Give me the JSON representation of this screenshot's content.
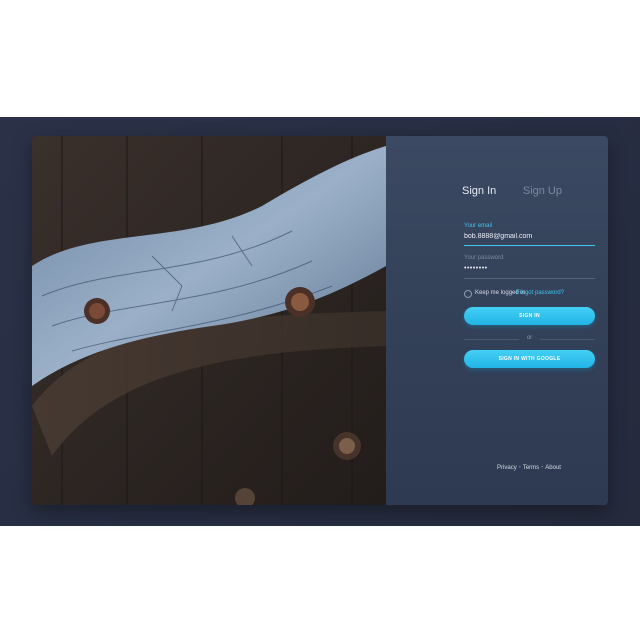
{
  "tabs": {
    "signin_label": "Sign In",
    "signup_label": "Sign Up"
  },
  "form": {
    "email_label": "Your email",
    "email_value": "bob.8888@gmail.com",
    "password_label": "Your password",
    "password_value": "••••••••",
    "keep_logged_in_label": "Keep me logged in",
    "forgot_password_label": "Forgot password?",
    "signin_button": "SIGN IN",
    "or_label": "or",
    "google_button": "SIGN IN WITH GOOGLE"
  },
  "footer": {
    "links": [
      "Privacy",
      "Terms",
      "About"
    ],
    "separator": "•"
  },
  "colors": {
    "accent": "#3fc6f1",
    "panel": "#34425a",
    "backdrop": "#2b3248"
  }
}
